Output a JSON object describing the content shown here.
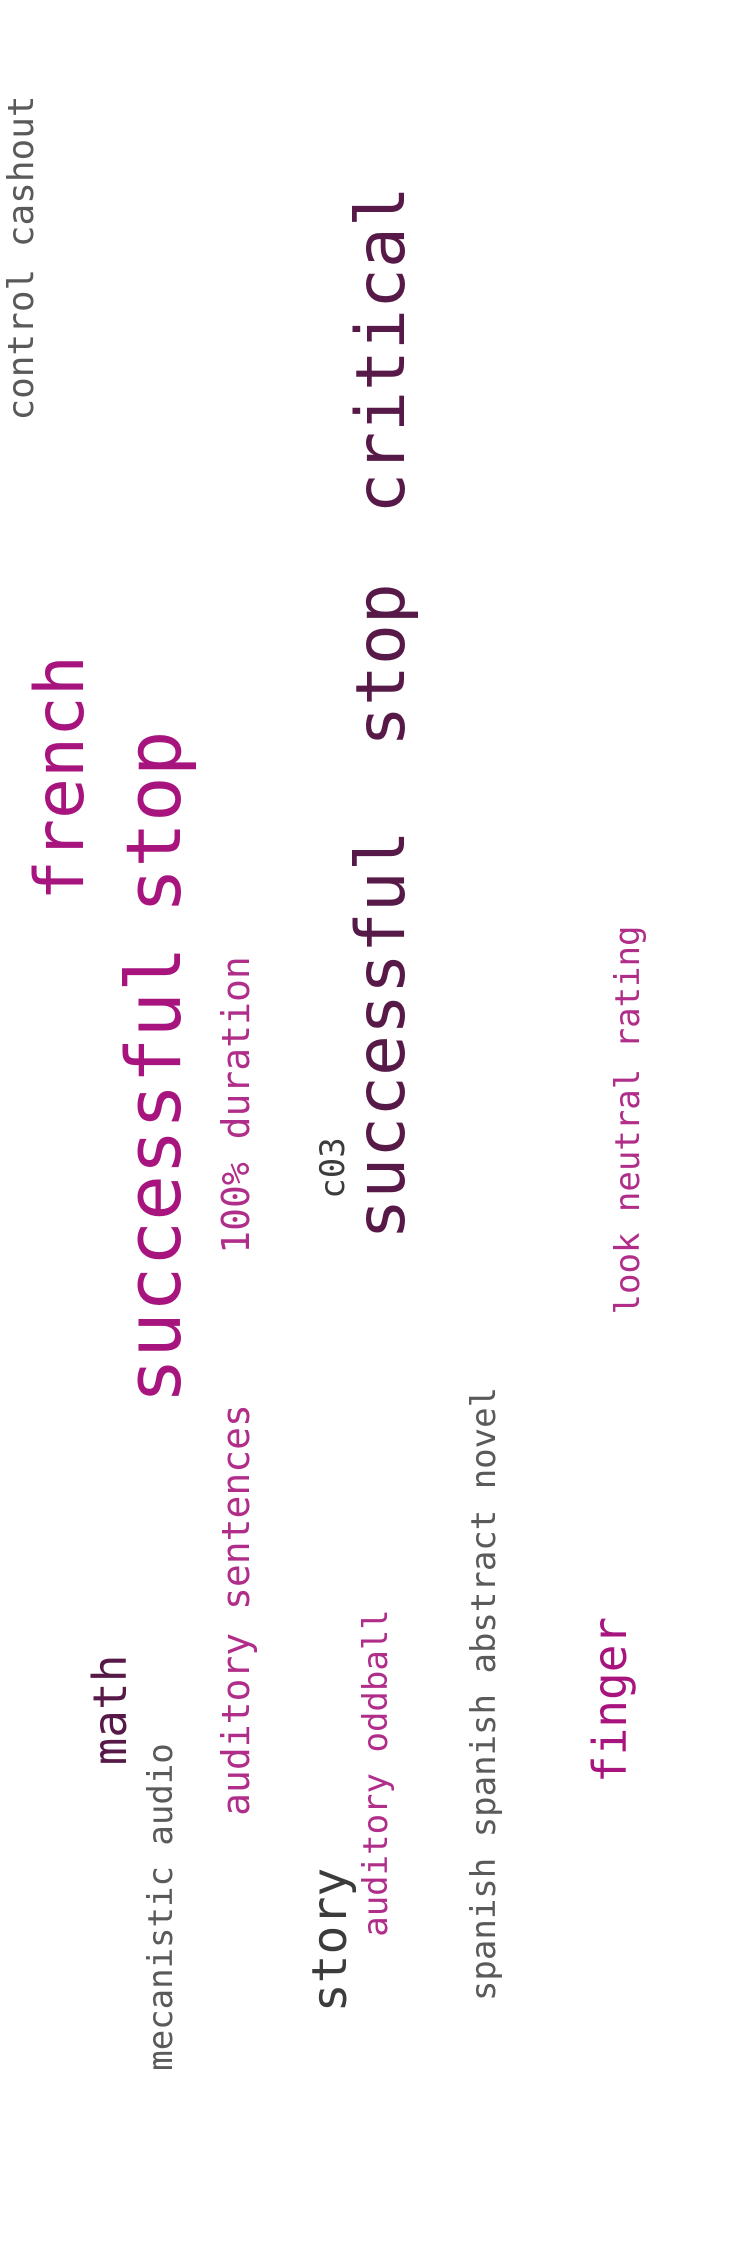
{
  "words": {
    "control_cashout": "control cashout",
    "critical": "critical",
    "french": "french",
    "stop_right": "stop",
    "stop_left": "stop",
    "successful_left": "successful",
    "successful_right": "successful",
    "duration": "100% duration",
    "c03": "c03",
    "rating": "look neutral rating",
    "sentences": "auditory sentences",
    "novel": "spanish spanish abstract novel",
    "math": "math",
    "mecanistic_audio": "mecanistic audio",
    "oddball": "auditory oddball",
    "story": "story",
    "finger": "finger"
  },
  "colors": {
    "magenta": "#a8147e",
    "plum": "#571a48",
    "gray": "#5a5a5a",
    "dark": "#3c3c3c"
  }
}
